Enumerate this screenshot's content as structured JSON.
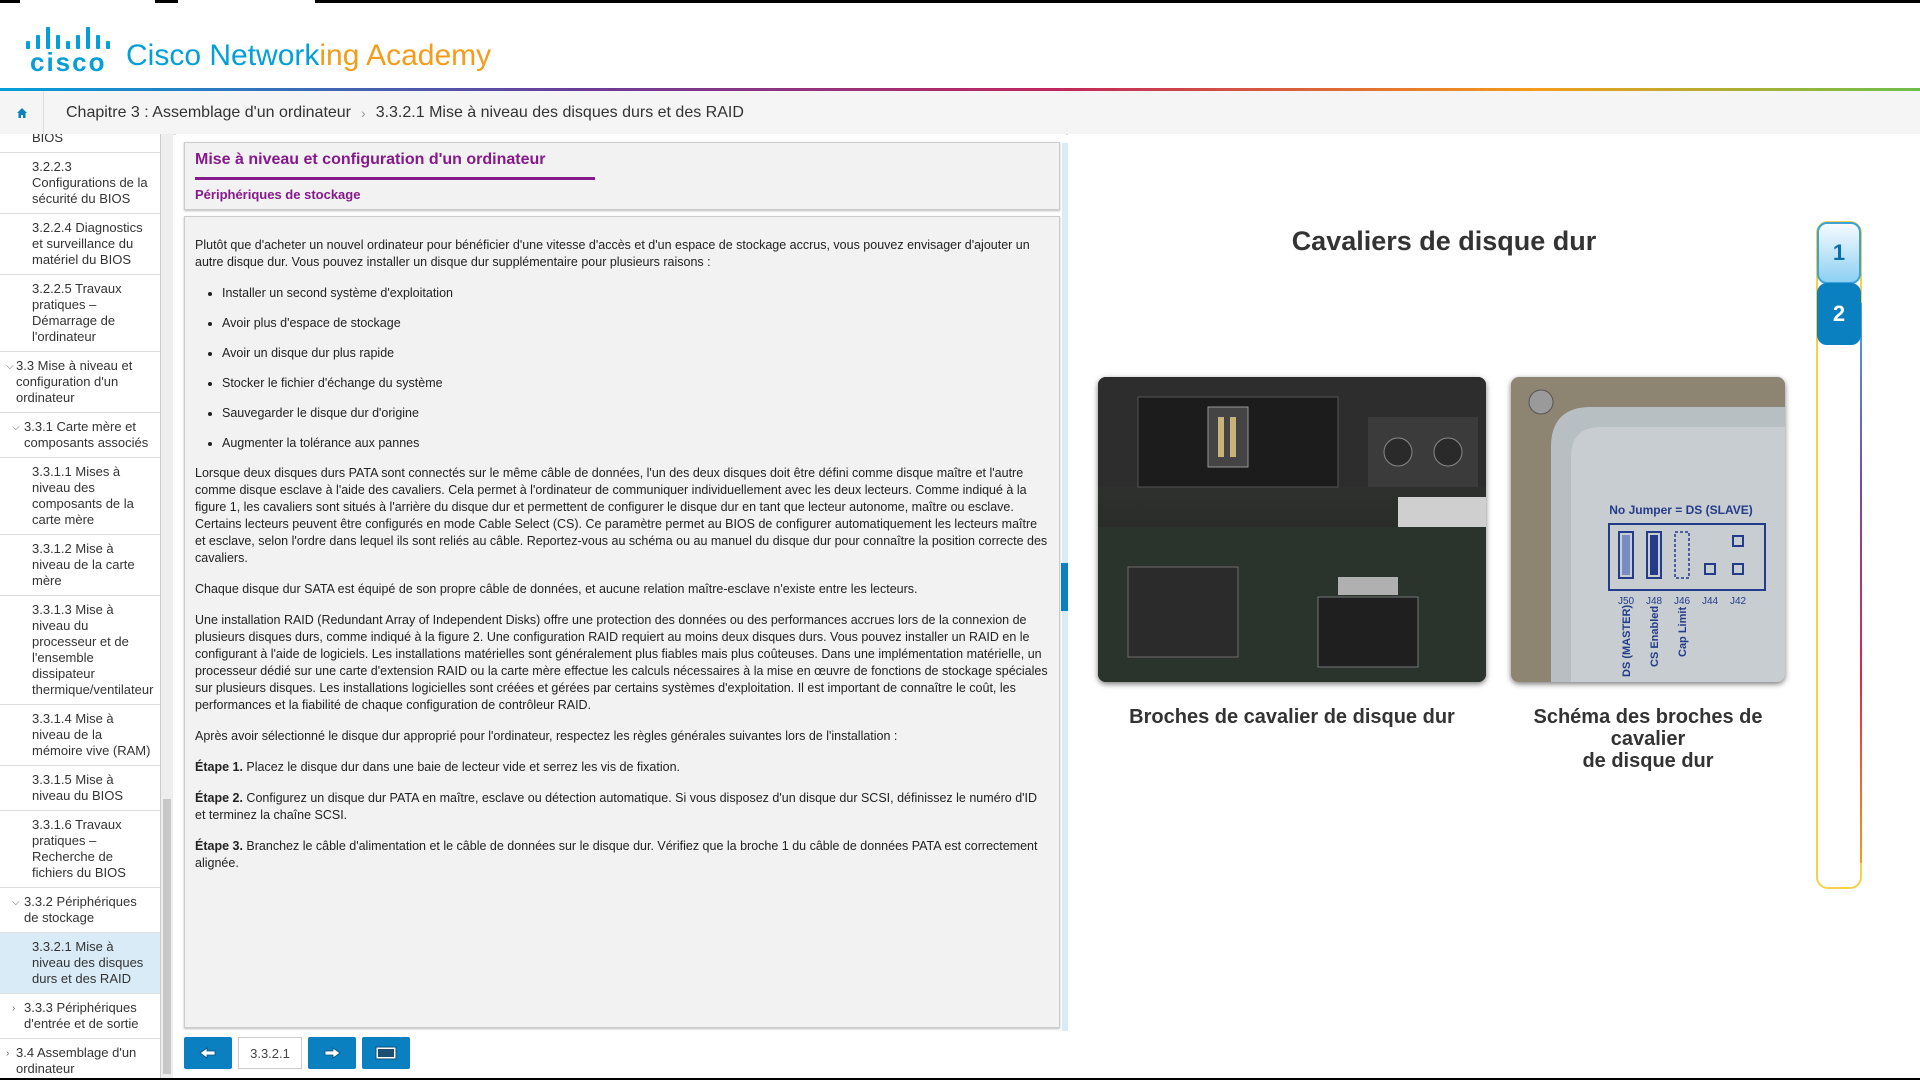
{
  "header": {
    "logo_text": "cisco",
    "app_title_a": "Cisco Network",
    "app_title_b": "ing Academy"
  },
  "breadcrumb": {
    "chapter": "Chapitre 3 : Assemblage d'un ordinateur",
    "section": "3.3.2.1 Mise à niveau des disques durs et des RAID"
  },
  "sidebar": {
    "items": [
      {
        "label": "BIOS",
        "level": 3
      },
      {
        "label": "3.2.2.3 Configurations de la sécurité du BIOS",
        "level": 3
      },
      {
        "label": "3.2.2.4 Diagnostics et surveillance du matériel du BIOS",
        "level": 3
      },
      {
        "label": "3.2.2.5 Travaux pratiques – Démarrage de l'ordinateur",
        "level": 3
      },
      {
        "label": "3.3 Mise à niveau et configuration d'un ordinateur",
        "level": 1,
        "chev": "⌵"
      },
      {
        "label": "3.3.1 Carte mère et composants associés",
        "level": 2,
        "chev": "⌵"
      },
      {
        "label": "3.3.1.1 Mises à niveau des composants de la carte mère",
        "level": 3
      },
      {
        "label": "3.3.1.2 Mise à niveau de la carte mère",
        "level": 3
      },
      {
        "label": "3.3.1.3 Mise à niveau du processeur et de l'ensemble dissipateur thermique/ventilateur",
        "level": 3
      },
      {
        "label": "3.3.1.4 Mise à niveau de la mémoire vive (RAM)",
        "level": 3
      },
      {
        "label": "3.3.1.5 Mise à niveau du BIOS",
        "level": 3
      },
      {
        "label": "3.3.1.6 Travaux pratiques – Recherche de fichiers du BIOS",
        "level": 3
      },
      {
        "label": "3.3.2 Périphériques de stockage",
        "level": 2,
        "chev": "⌵"
      },
      {
        "label": "3.3.2.1 Mise à niveau des disques durs et des RAID",
        "level": 3,
        "active": true
      },
      {
        "label": "3.3.3 Périphériques d'entrée et de sortie",
        "level": 2,
        "chev": "›"
      },
      {
        "label": "3.4 Assemblage d'un ordinateur",
        "level": 1,
        "chev": "›"
      }
    ]
  },
  "content": {
    "title": "Mise à niveau et configuration d'un ordinateur",
    "subtitle": "Périphériques de stockage",
    "intro": "Plutôt que d'acheter un nouvel ordinateur pour bénéficier d'une vitesse d'accès et d'un espace de stockage accrus, vous pouvez envisager d'ajouter un autre disque dur. Vous pouvez installer un disque dur supplémentaire pour plusieurs raisons :",
    "bullets": [
      "Installer un second système d'exploitation",
      "Avoir plus d'espace de stockage",
      "Avoir un disque dur plus rapide",
      "Stocker le fichier d'échange du système",
      "Sauvegarder le disque dur d'origine",
      "Augmenter la tolérance aux pannes"
    ],
    "para_pata": "Lorsque deux disques durs PATA sont connectés sur le même câble de données, l'un des deux disques doit être défini comme disque maître et l'autre comme disque esclave à l'aide des cavaliers. Cela permet à l'ordinateur de communiquer individuellement avec les deux lecteurs. Comme indiqué à la figure 1, les cavaliers sont situés à l'arrière du disque dur et permettent de configurer le disque dur en tant que lecteur autonome, maître ou esclave. Certains lecteurs peuvent être configurés en mode Cable Select (CS). Ce paramètre permet au BIOS de configurer automatiquement les lecteurs maître et esclave, selon l'ordre dans lequel ils sont reliés au câble. Reportez-vous au schéma ou au manuel du disque dur pour connaître la position correcte des cavaliers.",
    "para_sata": "Chaque disque dur SATA est équipé de son propre câble de données, et aucune relation maître-esclave n'existe entre les lecteurs.",
    "para_raid": "Une installation RAID (Redundant Array of Independent Disks) offre une protection des données ou des performances accrues lors de la connexion de plusieurs disques durs, comme indiqué à la figure 2. Une configuration RAID requiert au moins deux disques durs. Vous pouvez installer un RAID en le configurant à l'aide de logiciels. Les installations matérielles sont généralement plus fiables mais plus coûteuses. Dans une implémentation matérielle, un processeur dédié sur une carte d'extension RAID ou la carte mère effectue les calculs nécessaires à la mise en œuvre de fonctions de stockage spéciales sur plusieurs disques. Les installations logicielles sont créées et gérées par certains systèmes d'exploitation. Il est important de connaître le coût, les performances et la fiabilité de chaque configuration de contrôleur RAID.",
    "para_rules": "Après avoir sélectionné le disque dur approprié pour l'ordinateur, respectez les règles générales suivantes lors de l'installation :",
    "steps": [
      {
        "label": "Étape 1.",
        "text": " Placez le disque dur dans une baie de lecteur vide et serrez les vis de fixation."
      },
      {
        "label": "Étape 2.",
        "text": " Configurez un disque dur PATA en maître, esclave ou détection automatique. Si vous disposez d'un disque dur SCSI, définissez le numéro d'ID et terminez la chaîne SCSI."
      },
      {
        "label": "Étape 3.",
        "text": " Branchez le câble d'alimentation et le câble de données sur le disque dur. Vérifiez que la broche 1 du câble de données PATA est correctement alignée."
      }
    ]
  },
  "nav": {
    "page": "3.3.2.1"
  },
  "media": {
    "title": "Cavaliers de disque dur",
    "caption1": "Broches de cavalier de disque dur",
    "caption2_l1": "Schéma des broches de",
    "caption2_l2": "cavalier",
    "caption2_l3": "de disque dur",
    "diagram_heading": "No Jumper = DS (SLAVE)",
    "pins": [
      "J50",
      "J48",
      "J46",
      "J44",
      "J42"
    ],
    "pin_labels": [
      "DS (MASTER)",
      "CS Enabled",
      "Cap Limit"
    ],
    "tabs": [
      "1",
      "2"
    ],
    "active_tab": "2"
  },
  "colors": {
    "accent": "#049fd9",
    "purple": "#86198c",
    "nav_blue": "#0a80c1"
  }
}
